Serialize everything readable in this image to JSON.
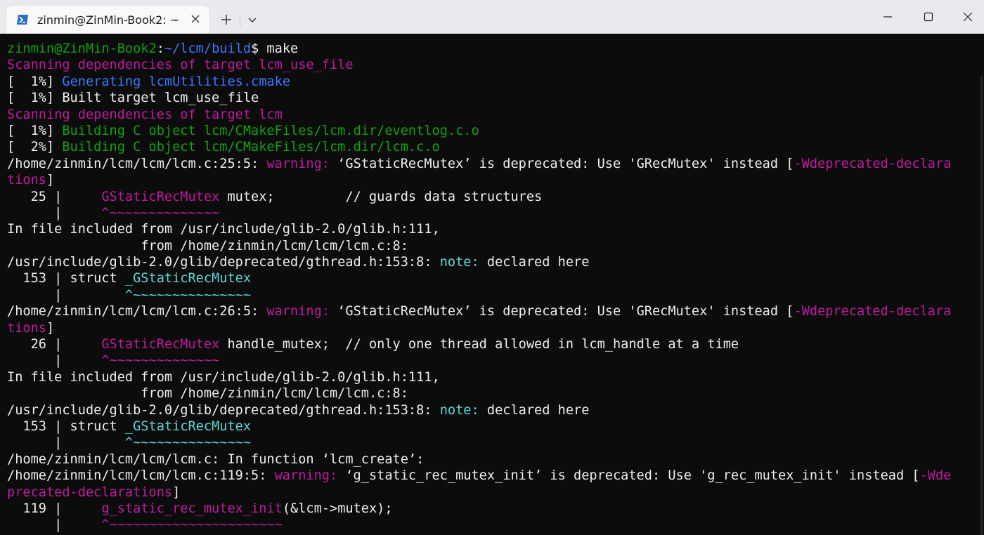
{
  "window": {
    "tab_title": "zinmin@ZinMin-Book2: ~",
    "tab_icon": "powershell-icon",
    "new_tab_icon": "plus-icon",
    "dropdown_icon": "chevron-down-icon"
  },
  "colors": {
    "white": "#eeeeee",
    "green": "#13a10e",
    "blue": "#3b78ff",
    "magenta": "#c01ca0",
    "cyan": "#61d6d6",
    "background": "#0c0c0c"
  },
  "terminal": {
    "lines": [
      [
        {
          "t": "zinmin@ZinMin-Book2",
          "c": "green"
        },
        {
          "t": ":",
          "c": "white"
        },
        {
          "t": "~/lcm/build",
          "c": "blue"
        },
        {
          "t": "$ make",
          "c": "white"
        }
      ],
      [
        {
          "t": "Scanning dependencies of target lcm_use_file",
          "c": "magenta"
        }
      ],
      [
        {
          "t": "[  1%] ",
          "c": "white"
        },
        {
          "t": "Generating lcmUtilities.cmake",
          "c": "blue"
        }
      ],
      [
        {
          "t": "[  1%] Built target lcm_use_file",
          "c": "white"
        }
      ],
      [
        {
          "t": "Scanning dependencies of target lcm",
          "c": "magenta"
        }
      ],
      [
        {
          "t": "[  1%] ",
          "c": "white"
        },
        {
          "t": "Building C object lcm/CMakeFiles/lcm.dir/eventlog.c.o",
          "c": "green"
        }
      ],
      [
        {
          "t": "[  2%] ",
          "c": "white"
        },
        {
          "t": "Building C object lcm/CMakeFiles/lcm.dir/lcm.c.o",
          "c": "green"
        }
      ],
      [
        {
          "t": "/home/zinmin/lcm/lcm/lcm.c:25:5: ",
          "c": "white"
        },
        {
          "t": "warning:",
          "c": "magenta"
        },
        {
          "t": " ‘GStaticRecMutex’ is deprecated: Use 'GRecMutex' instead [",
          "c": "white"
        },
        {
          "t": "-Wdeprecated-declara",
          "c": "magenta"
        }
      ],
      [
        {
          "t": "tions",
          "c": "magenta"
        },
        {
          "t": "]",
          "c": "white"
        }
      ],
      [
        {
          "t": "   25 |     ",
          "c": "white"
        },
        {
          "t": "GStaticRecMutex",
          "c": "magenta"
        },
        {
          "t": " mutex;         // guards data structures",
          "c": "white"
        }
      ],
      [
        {
          "t": "      |     ",
          "c": "white"
        },
        {
          "t": "^~~~~~~~~~~~~~~",
          "c": "magenta"
        }
      ],
      [
        {
          "t": "In file included from /usr/include/glib-2.0/glib.h:111,",
          "c": "white"
        }
      ],
      [
        {
          "t": "                 from /home/zinmin/lcm/lcm/lcm.c:8:",
          "c": "white"
        }
      ],
      [
        {
          "t": "/usr/include/glib-2.0/glib/deprecated/gthread.h:153:8: ",
          "c": "white"
        },
        {
          "t": "note:",
          "c": "cyan"
        },
        {
          "t": " declared here",
          "c": "white"
        }
      ],
      [
        {
          "t": "  153 | struct ",
          "c": "white"
        },
        {
          "t": "_GStaticRecMutex",
          "c": "cyan"
        }
      ],
      [
        {
          "t": "      |        ",
          "c": "white"
        },
        {
          "t": "^~~~~~~~~~~~~~~~",
          "c": "cyan"
        }
      ],
      [
        {
          "t": "/home/zinmin/lcm/lcm/lcm.c:26:5: ",
          "c": "white"
        },
        {
          "t": "warning:",
          "c": "magenta"
        },
        {
          "t": " ‘GStaticRecMutex’ is deprecated: Use 'GRecMutex' instead [",
          "c": "white"
        },
        {
          "t": "-Wdeprecated-declara",
          "c": "magenta"
        }
      ],
      [
        {
          "t": "tions",
          "c": "magenta"
        },
        {
          "t": "]",
          "c": "white"
        }
      ],
      [
        {
          "t": "   26 |     ",
          "c": "white"
        },
        {
          "t": "GStaticRecMutex",
          "c": "magenta"
        },
        {
          "t": " handle_mutex;  // only one thread allowed in lcm_handle at a time",
          "c": "white"
        }
      ],
      [
        {
          "t": "      |     ",
          "c": "white"
        },
        {
          "t": "^~~~~~~~~~~~~~~",
          "c": "magenta"
        }
      ],
      [
        {
          "t": "In file included from /usr/include/glib-2.0/glib.h:111,",
          "c": "white"
        }
      ],
      [
        {
          "t": "                 from /home/zinmin/lcm/lcm/lcm.c:8:",
          "c": "white"
        }
      ],
      [
        {
          "t": "/usr/include/glib-2.0/glib/deprecated/gthread.h:153:8: ",
          "c": "white"
        },
        {
          "t": "note:",
          "c": "cyan"
        },
        {
          "t": " declared here",
          "c": "white"
        }
      ],
      [
        {
          "t": "  153 | struct ",
          "c": "white"
        },
        {
          "t": "_GStaticRecMutex",
          "c": "cyan"
        }
      ],
      [
        {
          "t": "      |        ",
          "c": "white"
        },
        {
          "t": "^~~~~~~~~~~~~~~~",
          "c": "cyan"
        }
      ],
      [
        {
          "t": "/home/zinmin/lcm/lcm/lcm.c: In function ‘lcm_create’:",
          "c": "white"
        }
      ],
      [
        {
          "t": "/home/zinmin/lcm/lcm/lcm.c:119:5: ",
          "c": "white"
        },
        {
          "t": "warning:",
          "c": "magenta"
        },
        {
          "t": " ‘g_static_rec_mutex_init’ is deprecated: Use 'g_rec_mutex_init' instead [",
          "c": "white"
        },
        {
          "t": "-Wde",
          "c": "magenta"
        }
      ],
      [
        {
          "t": "precated-declarations",
          "c": "magenta"
        },
        {
          "t": "]",
          "c": "white"
        }
      ],
      [
        {
          "t": "  119 |     ",
          "c": "white"
        },
        {
          "t": "g_static_rec_mutex_init",
          "c": "magenta"
        },
        {
          "t": "(&lcm->mutex);",
          "c": "white"
        }
      ],
      [
        {
          "t": "      |     ",
          "c": "white"
        },
        {
          "t": "^~~~~~~~~~~~~~~~~~~~~~~",
          "c": "magenta"
        }
      ]
    ]
  }
}
